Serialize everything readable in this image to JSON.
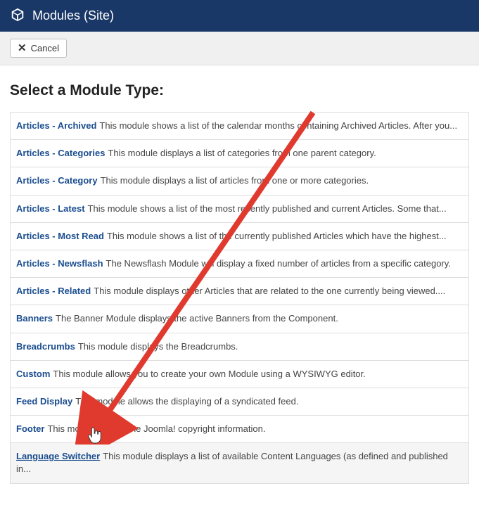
{
  "header": {
    "title": "Modules (Site)"
  },
  "toolbar": {
    "cancel_label": "Cancel"
  },
  "heading": "Select a Module Type:",
  "modules": [
    {
      "name": "Articles - Archived",
      "desc": "This module shows a list of the calendar months containing Archived Articles. After you..."
    },
    {
      "name": "Articles - Categories",
      "desc": "This module displays a list of categories from one parent category."
    },
    {
      "name": "Articles - Category",
      "desc": "This module displays a list of articles from one or more categories."
    },
    {
      "name": "Articles - Latest",
      "desc": "This module shows a list of the most recently published and current Articles. Some that..."
    },
    {
      "name": "Articles - Most Read",
      "desc": "This module shows a list of the currently published Articles which have the highest..."
    },
    {
      "name": "Articles - Newsflash",
      "desc": "The Newsflash Module will display a fixed number of articles from a specific category."
    },
    {
      "name": "Articles - Related",
      "desc": "This module displays other Articles that are related to the one currently being viewed...."
    },
    {
      "name": "Banners",
      "desc": "The Banner Module displays the active Banners from the Component."
    },
    {
      "name": "Breadcrumbs",
      "desc": "This module displays the Breadcrumbs."
    },
    {
      "name": "Custom",
      "desc": "This module allows you to create your own Module using a WYSIWYG editor."
    },
    {
      "name": "Feed Display",
      "desc": "This module allows the displaying of a syndicated feed."
    },
    {
      "name": "Footer",
      "desc": "This module shows the Joomla! copyright information."
    },
    {
      "name": "Language Switcher",
      "desc": "This module displays a list of available Content Languages (as defined and published in..."
    }
  ],
  "highlight_index": 12
}
